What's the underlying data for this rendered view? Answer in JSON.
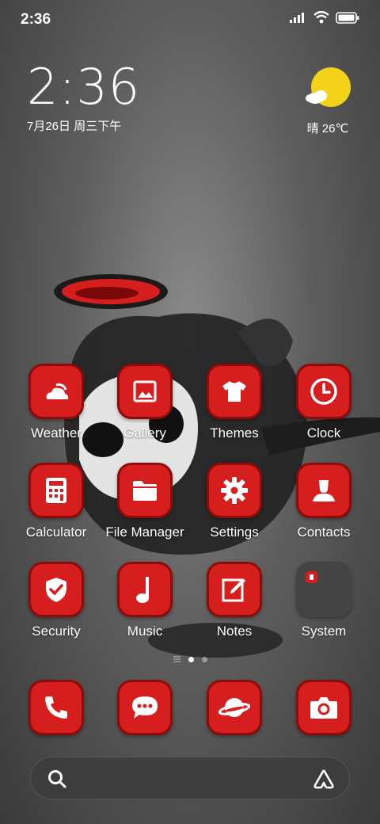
{
  "status_bar": {
    "time": "2:36",
    "icons": [
      "signal-icon",
      "wifi-icon",
      "battery-icon"
    ]
  },
  "clock_widget": {
    "time": "2:36",
    "date": "7月26日 周三下午"
  },
  "weather_widget": {
    "text": "晴 26℃",
    "icon": "sun-cloud-icon"
  },
  "apps_row1": [
    {
      "label": "Weather",
      "icon": "weather-icon"
    },
    {
      "label": "Gallery",
      "icon": "gallery-icon"
    },
    {
      "label": "Themes",
      "icon": "themes-icon"
    },
    {
      "label": "Clock",
      "icon": "clock-icon"
    }
  ],
  "apps_row2": [
    {
      "label": "Calculator",
      "icon": "calculator-icon"
    },
    {
      "label": "File Manager",
      "icon": "folder-icon"
    },
    {
      "label": "Settings",
      "icon": "gear-icon"
    },
    {
      "label": "Contacts",
      "icon": "contacts-icon"
    }
  ],
  "apps_row3": [
    {
      "label": "Security",
      "icon": "shield-icon"
    },
    {
      "label": "Music",
      "icon": "music-note-icon"
    },
    {
      "label": "Notes",
      "icon": "notes-icon"
    },
    {
      "label": "System",
      "icon": "folder-tile"
    }
  ],
  "page_indicator": {
    "pages": 2,
    "current": 1
  },
  "dock": [
    {
      "icon": "phone-icon"
    },
    {
      "icon": "message-icon"
    },
    {
      "icon": "browser-planet-icon"
    },
    {
      "icon": "camera-icon"
    }
  ],
  "search_bar": {
    "left_icon": "search-icon",
    "right_icon": "assistant-icon"
  },
  "colors": {
    "accent": "#d71e1e",
    "accent_border": "#8e0b0b"
  }
}
